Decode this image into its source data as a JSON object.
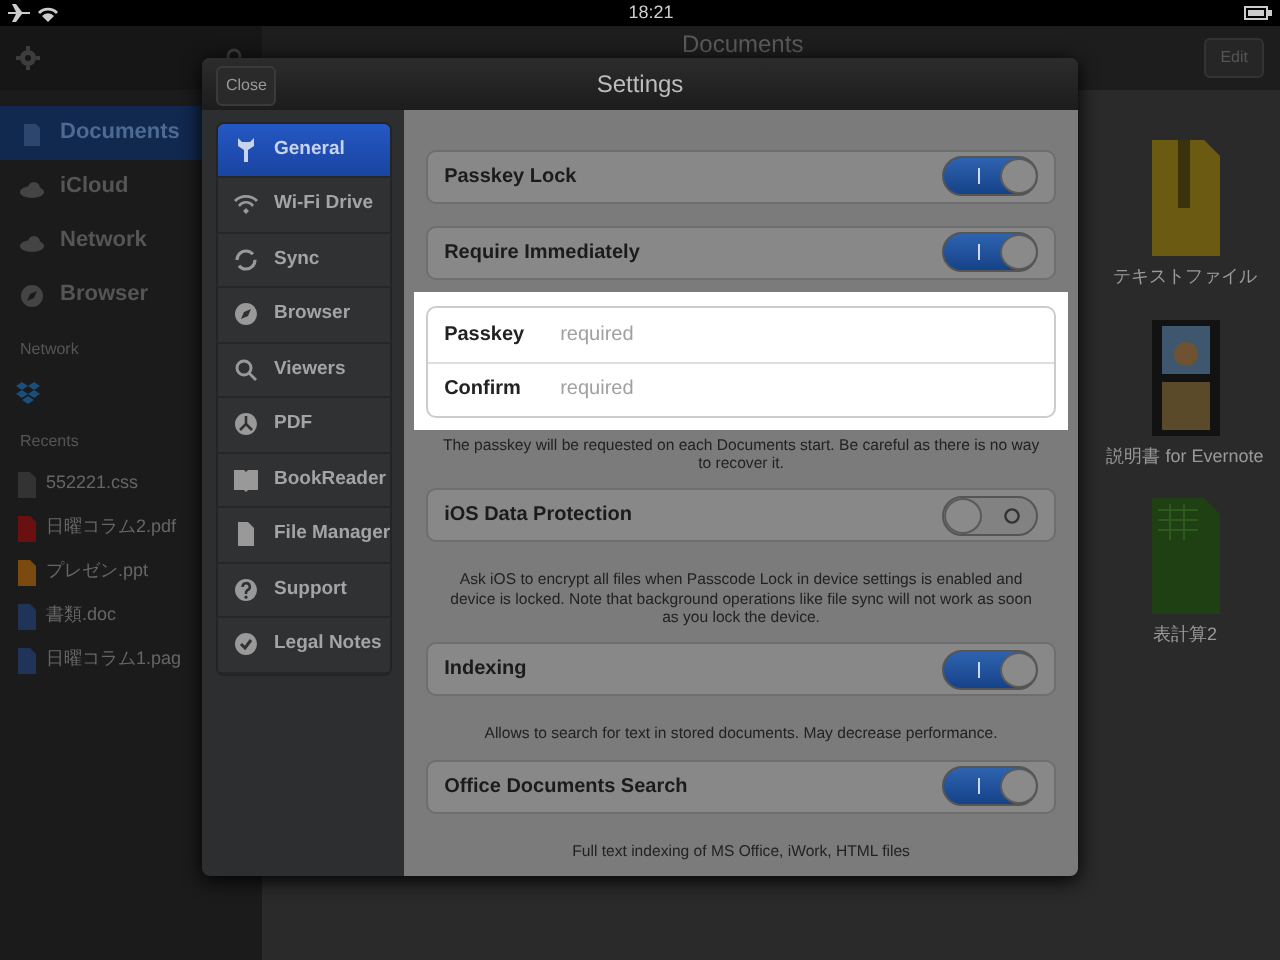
{
  "status_bar": {
    "time": "18:21"
  },
  "sidebar": {
    "items": [
      {
        "label": "Documents",
        "selected": true
      },
      {
        "label": "iCloud",
        "selected": false
      },
      {
        "label": "Network",
        "selected": false
      },
      {
        "label": "Browser",
        "selected": false
      }
    ],
    "network_title": "Network",
    "recents_title": "Recents",
    "recents": [
      {
        "name": "552221.css",
        "kind": "css"
      },
      {
        "name": "日曜コラム2.pdf",
        "kind": "pdf"
      },
      {
        "name": "プレゼン.ppt",
        "kind": "ppt"
      },
      {
        "name": "書類.doc",
        "kind": "doc"
      },
      {
        "name": "日曜コラム1.pag",
        "kind": "pages"
      }
    ]
  },
  "main": {
    "title": "Documents",
    "edit_button": "Edit",
    "files": [
      {
        "name": "テキストファイル",
        "kind": "zip"
      },
      {
        "name": "説明書 for Evernote",
        "kind": "video"
      },
      {
        "name": "表計算2",
        "kind": "xls"
      }
    ]
  },
  "settings": {
    "close_button": "Close",
    "title": "Settings",
    "menu": [
      {
        "label": "General",
        "selected": true
      },
      {
        "label": "Wi-Fi Drive",
        "selected": false
      },
      {
        "label": "Sync",
        "selected": false
      },
      {
        "label": "Browser",
        "selected": false
      },
      {
        "label": "Viewers",
        "selected": false
      },
      {
        "label": "PDF",
        "selected": false
      },
      {
        "label": "BookReader",
        "selected": false
      },
      {
        "label": "File Manager",
        "selected": false
      },
      {
        "label": "Support",
        "selected": false
      },
      {
        "label": "Legal Notes",
        "selected": false
      }
    ],
    "content": [
      {
        "kind": "toggle",
        "label": "Passkey Lock",
        "on": true
      },
      {
        "kind": "toggle",
        "label": "Require Immediately",
        "on": true
      },
      {
        "kind": "fields",
        "fields": [
          {
            "label": "Passkey",
            "placeholder": "required"
          },
          {
            "label": "Confirm",
            "placeholder": "required"
          }
        ]
      },
      {
        "kind": "note",
        "text": "The passkey will be requested on each Documents start. Be careful as there is no way to recover it."
      },
      {
        "kind": "toggle",
        "label": "iOS Data Protection",
        "on": false
      },
      {
        "kind": "note",
        "text": "Ask iOS to encrypt all files when Passcode Lock in device settings is enabled and device is locked. Note that background operations like file sync will not work as soon as you lock the device."
      },
      {
        "kind": "toggle",
        "label": "Indexing",
        "on": true
      },
      {
        "kind": "note",
        "text": "Allows to search for text in stored documents. May decrease performance."
      },
      {
        "kind": "toggle",
        "label": "Office Documents Search",
        "on": true
      },
      {
        "kind": "note",
        "text": "Full text indexing of MS Office, iWork, HTML files"
      }
    ]
  }
}
